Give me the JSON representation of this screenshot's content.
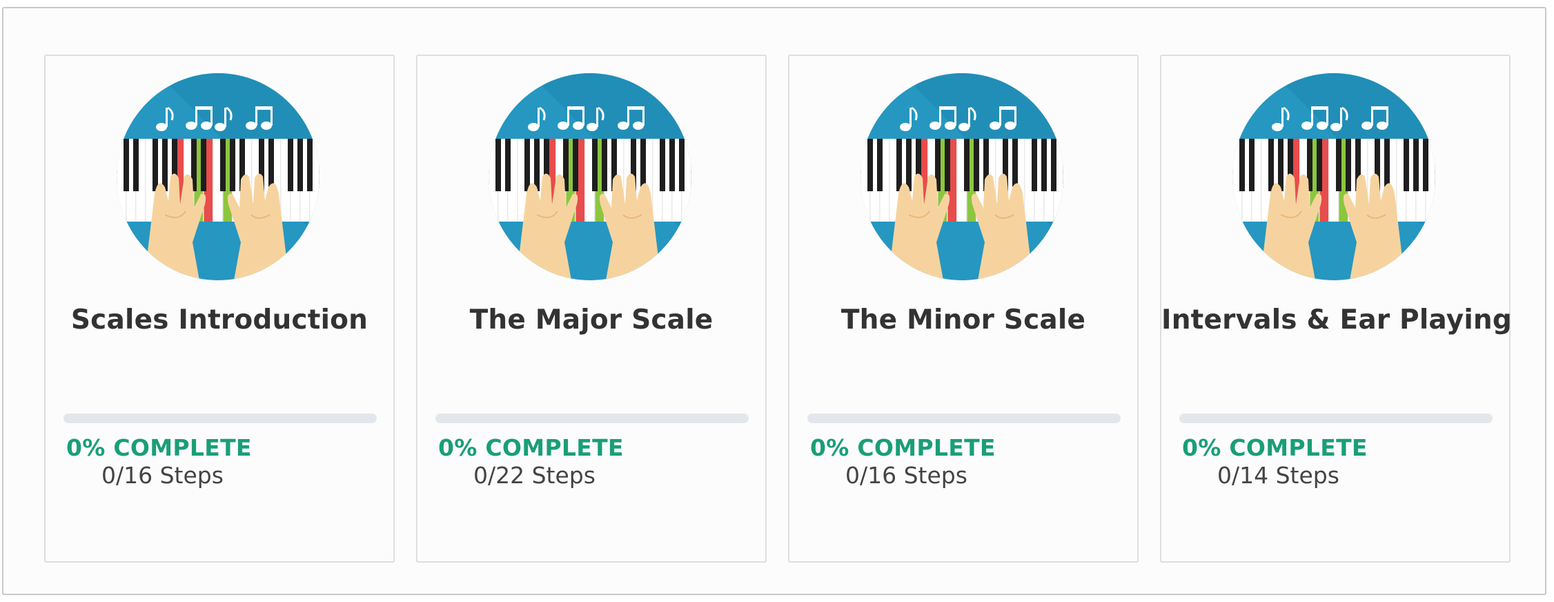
{
  "colors": {
    "accent_green": "#1a9e78",
    "thumb_blue": "#2597c1",
    "progress_track": "#e3e7ec",
    "title_text": "#333333"
  },
  "courses": [
    {
      "title": "Scales Introduction",
      "progress_percent": 0,
      "complete_label": "0% COMPLETE",
      "steps_label": "0/16 Steps",
      "icon": "piano-hands-icon"
    },
    {
      "title": "The Major Scale",
      "progress_percent": 0,
      "complete_label": "0% COMPLETE",
      "steps_label": "0/22 Steps",
      "icon": "piano-hands-icon"
    },
    {
      "title": "The Minor Scale",
      "progress_percent": 0,
      "complete_label": "0% COMPLETE",
      "steps_label": "0/16 Steps",
      "icon": "piano-hands-icon"
    },
    {
      "title": "Intervals & Ear Playing",
      "progress_percent": 0,
      "complete_label": "0% COMPLETE",
      "steps_label": "0/14 Steps",
      "icon": "piano-hands-icon"
    }
  ]
}
